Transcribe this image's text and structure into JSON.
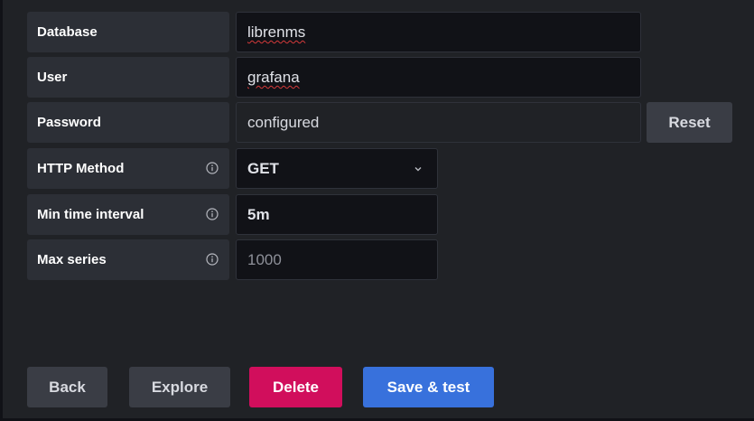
{
  "form": {
    "database": {
      "label": "Database",
      "value": "librenms"
    },
    "user": {
      "label": "User",
      "value": "grafana"
    },
    "password": {
      "label": "Password",
      "value": "configured",
      "reset_label": "Reset"
    },
    "http_method": {
      "label": "HTTP Method",
      "value": "GET",
      "icon": "info-icon"
    },
    "min_time_interval": {
      "label": "Min time interval",
      "value": "5m",
      "icon": "info-icon"
    },
    "max_series": {
      "label": "Max series",
      "placeholder": "1000",
      "icon": "info-icon"
    }
  },
  "actions": {
    "back_label": "Back",
    "explore_label": "Explore",
    "delete_label": "Delete",
    "save_test_label": "Save & test"
  },
  "colors": {
    "background": "#202226",
    "label_bg": "#2c2f36",
    "input_bg": "#111217",
    "danger": "#d10e5c",
    "primary": "#3871dc",
    "secondary": "#3a3d45"
  }
}
